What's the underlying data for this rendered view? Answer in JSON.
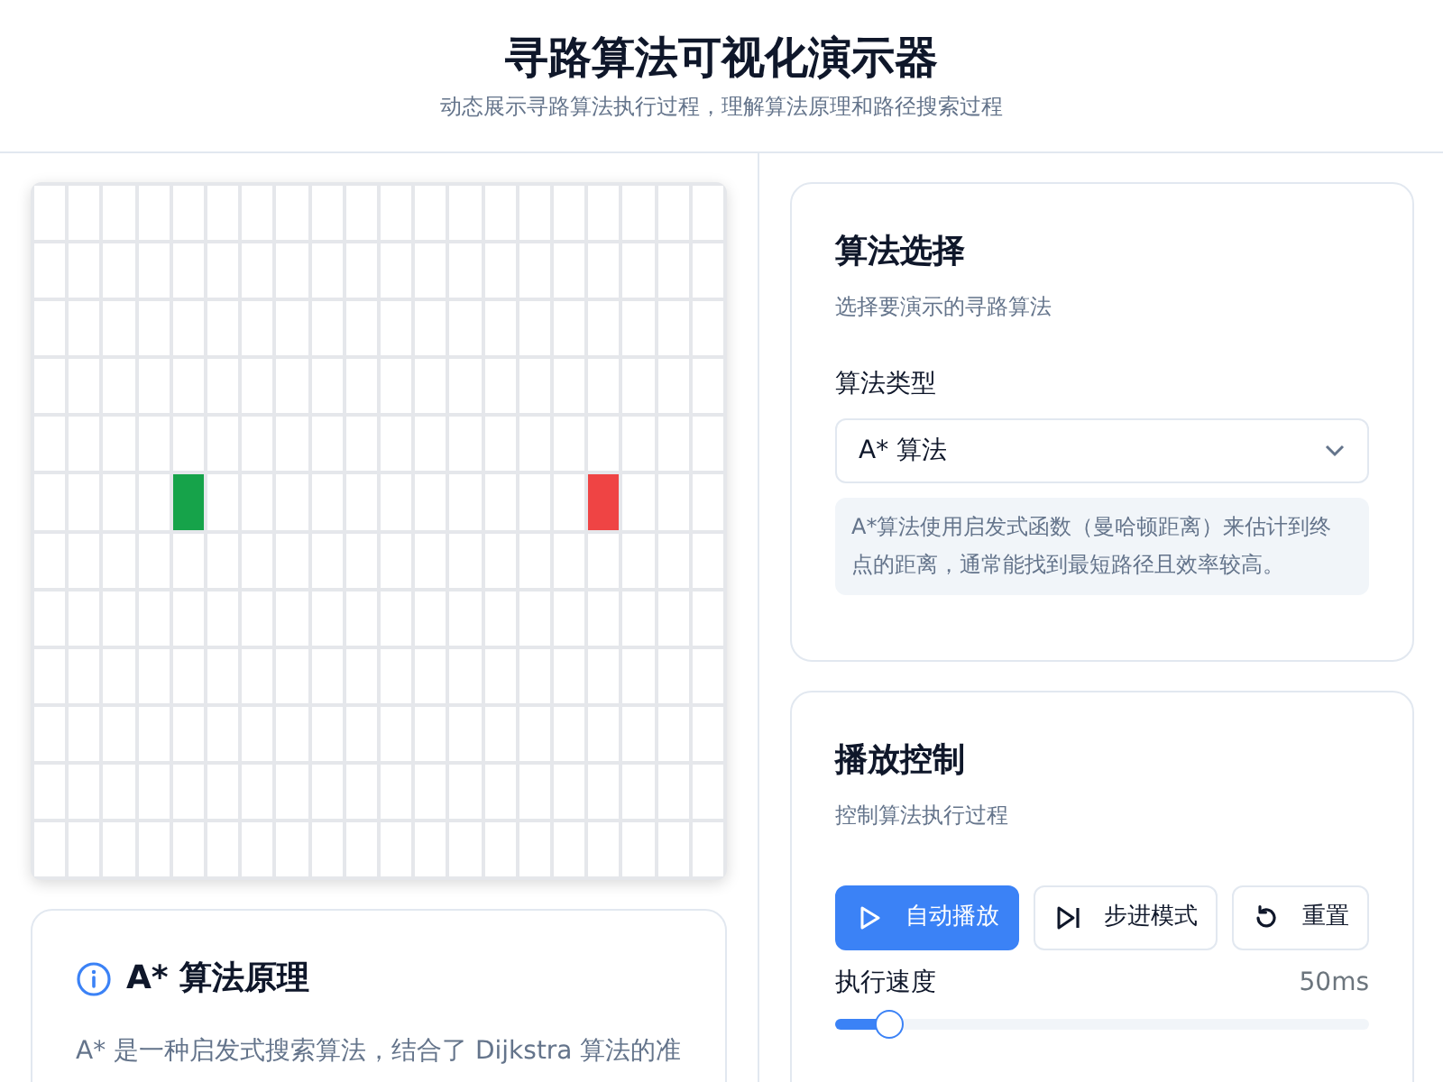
{
  "header": {
    "title": "寻路算法可视化演示器",
    "subtitle": "动态展示寻路算法执行过程，理解算法原理和路径搜索过程"
  },
  "grid": {
    "rows": [
      {
        "cells": [
          {
            "kind": "empty"
          },
          {
            "kind": "empty"
          },
          {
            "kind": "empty"
          },
          {
            "kind": "empty"
          },
          {
            "kind": "empty"
          },
          {
            "kind": "empty"
          },
          {
            "kind": "empty"
          },
          {
            "kind": "empty"
          },
          {
            "kind": "empty"
          },
          {
            "kind": "empty"
          },
          {
            "kind": "empty"
          },
          {
            "kind": "empty"
          },
          {
            "kind": "empty"
          },
          {
            "kind": "empty"
          },
          {
            "kind": "empty"
          },
          {
            "kind": "empty"
          },
          {
            "kind": "empty"
          },
          {
            "kind": "empty"
          },
          {
            "kind": "empty"
          },
          {
            "kind": "empty"
          }
        ]
      },
      {
        "cells": [
          {
            "kind": "empty"
          },
          {
            "kind": "empty"
          },
          {
            "kind": "empty"
          },
          {
            "kind": "empty"
          },
          {
            "kind": "empty"
          },
          {
            "kind": "empty"
          },
          {
            "kind": "empty"
          },
          {
            "kind": "empty"
          },
          {
            "kind": "empty"
          },
          {
            "kind": "empty"
          },
          {
            "kind": "empty"
          },
          {
            "kind": "empty"
          },
          {
            "kind": "empty"
          },
          {
            "kind": "empty"
          },
          {
            "kind": "empty"
          },
          {
            "kind": "empty"
          },
          {
            "kind": "empty"
          },
          {
            "kind": "empty"
          },
          {
            "kind": "empty"
          },
          {
            "kind": "empty"
          }
        ]
      },
      {
        "cells": [
          {
            "kind": "empty"
          },
          {
            "kind": "empty"
          },
          {
            "kind": "empty"
          },
          {
            "kind": "empty"
          },
          {
            "kind": "empty"
          },
          {
            "kind": "empty"
          },
          {
            "kind": "empty"
          },
          {
            "kind": "empty"
          },
          {
            "kind": "empty"
          },
          {
            "kind": "empty"
          },
          {
            "kind": "empty"
          },
          {
            "kind": "empty"
          },
          {
            "kind": "empty"
          },
          {
            "kind": "empty"
          },
          {
            "kind": "empty"
          },
          {
            "kind": "empty"
          },
          {
            "kind": "empty"
          },
          {
            "kind": "empty"
          },
          {
            "kind": "empty"
          },
          {
            "kind": "empty"
          }
        ]
      },
      {
        "cells": [
          {
            "kind": "empty"
          },
          {
            "kind": "empty"
          },
          {
            "kind": "empty"
          },
          {
            "kind": "empty"
          },
          {
            "kind": "empty"
          },
          {
            "kind": "empty"
          },
          {
            "kind": "empty"
          },
          {
            "kind": "empty"
          },
          {
            "kind": "empty"
          },
          {
            "kind": "empty"
          },
          {
            "kind": "empty"
          },
          {
            "kind": "empty"
          },
          {
            "kind": "empty"
          },
          {
            "kind": "empty"
          },
          {
            "kind": "empty"
          },
          {
            "kind": "empty"
          },
          {
            "kind": "empty"
          },
          {
            "kind": "empty"
          },
          {
            "kind": "empty"
          },
          {
            "kind": "empty"
          }
        ]
      },
      {
        "cells": [
          {
            "kind": "empty"
          },
          {
            "kind": "empty"
          },
          {
            "kind": "empty"
          },
          {
            "kind": "empty"
          },
          {
            "kind": "empty"
          },
          {
            "kind": "empty"
          },
          {
            "kind": "empty"
          },
          {
            "kind": "empty"
          },
          {
            "kind": "empty"
          },
          {
            "kind": "empty"
          },
          {
            "kind": "empty"
          },
          {
            "kind": "empty"
          },
          {
            "kind": "empty"
          },
          {
            "kind": "empty"
          },
          {
            "kind": "empty"
          },
          {
            "kind": "empty"
          },
          {
            "kind": "empty"
          },
          {
            "kind": "empty"
          },
          {
            "kind": "empty"
          },
          {
            "kind": "empty"
          }
        ]
      },
      {
        "cells": [
          {
            "kind": "empty"
          },
          {
            "kind": "empty"
          },
          {
            "kind": "empty"
          },
          {
            "kind": "empty"
          },
          {
            "kind": "start"
          },
          {
            "kind": "empty"
          },
          {
            "kind": "empty"
          },
          {
            "kind": "empty"
          },
          {
            "kind": "empty"
          },
          {
            "kind": "empty"
          },
          {
            "kind": "empty"
          },
          {
            "kind": "empty"
          },
          {
            "kind": "empty"
          },
          {
            "kind": "empty"
          },
          {
            "kind": "empty"
          },
          {
            "kind": "empty"
          },
          {
            "kind": "end"
          },
          {
            "kind": "empty"
          },
          {
            "kind": "empty"
          },
          {
            "kind": "empty"
          }
        ]
      },
      {
        "cells": [
          {
            "kind": "empty"
          },
          {
            "kind": "empty"
          },
          {
            "kind": "empty"
          },
          {
            "kind": "empty"
          },
          {
            "kind": "empty"
          },
          {
            "kind": "empty"
          },
          {
            "kind": "empty"
          },
          {
            "kind": "empty"
          },
          {
            "kind": "empty"
          },
          {
            "kind": "empty"
          },
          {
            "kind": "empty"
          },
          {
            "kind": "empty"
          },
          {
            "kind": "empty"
          },
          {
            "kind": "empty"
          },
          {
            "kind": "empty"
          },
          {
            "kind": "empty"
          },
          {
            "kind": "empty"
          },
          {
            "kind": "empty"
          },
          {
            "kind": "empty"
          },
          {
            "kind": "empty"
          }
        ]
      },
      {
        "cells": [
          {
            "kind": "empty"
          },
          {
            "kind": "empty"
          },
          {
            "kind": "empty"
          },
          {
            "kind": "empty"
          },
          {
            "kind": "empty"
          },
          {
            "kind": "empty"
          },
          {
            "kind": "empty"
          },
          {
            "kind": "empty"
          },
          {
            "kind": "empty"
          },
          {
            "kind": "empty"
          },
          {
            "kind": "empty"
          },
          {
            "kind": "empty"
          },
          {
            "kind": "empty"
          },
          {
            "kind": "empty"
          },
          {
            "kind": "empty"
          },
          {
            "kind": "empty"
          },
          {
            "kind": "empty"
          },
          {
            "kind": "empty"
          },
          {
            "kind": "empty"
          },
          {
            "kind": "empty"
          }
        ]
      },
      {
        "cells": [
          {
            "kind": "empty"
          },
          {
            "kind": "empty"
          },
          {
            "kind": "empty"
          },
          {
            "kind": "empty"
          },
          {
            "kind": "empty"
          },
          {
            "kind": "empty"
          },
          {
            "kind": "empty"
          },
          {
            "kind": "empty"
          },
          {
            "kind": "empty"
          },
          {
            "kind": "empty"
          },
          {
            "kind": "empty"
          },
          {
            "kind": "empty"
          },
          {
            "kind": "empty"
          },
          {
            "kind": "empty"
          },
          {
            "kind": "empty"
          },
          {
            "kind": "empty"
          },
          {
            "kind": "empty"
          },
          {
            "kind": "empty"
          },
          {
            "kind": "empty"
          },
          {
            "kind": "empty"
          }
        ]
      },
      {
        "cells": [
          {
            "kind": "empty"
          },
          {
            "kind": "empty"
          },
          {
            "kind": "empty"
          },
          {
            "kind": "empty"
          },
          {
            "kind": "empty"
          },
          {
            "kind": "empty"
          },
          {
            "kind": "empty"
          },
          {
            "kind": "empty"
          },
          {
            "kind": "empty"
          },
          {
            "kind": "empty"
          },
          {
            "kind": "empty"
          },
          {
            "kind": "empty"
          },
          {
            "kind": "empty"
          },
          {
            "kind": "empty"
          },
          {
            "kind": "empty"
          },
          {
            "kind": "empty"
          },
          {
            "kind": "empty"
          },
          {
            "kind": "empty"
          },
          {
            "kind": "empty"
          },
          {
            "kind": "empty"
          }
        ]
      },
      {
        "cells": [
          {
            "kind": "empty"
          },
          {
            "kind": "empty"
          },
          {
            "kind": "empty"
          },
          {
            "kind": "empty"
          },
          {
            "kind": "empty"
          },
          {
            "kind": "empty"
          },
          {
            "kind": "empty"
          },
          {
            "kind": "empty"
          },
          {
            "kind": "empty"
          },
          {
            "kind": "empty"
          },
          {
            "kind": "empty"
          },
          {
            "kind": "empty"
          },
          {
            "kind": "empty"
          },
          {
            "kind": "empty"
          },
          {
            "kind": "empty"
          },
          {
            "kind": "empty"
          },
          {
            "kind": "empty"
          },
          {
            "kind": "empty"
          },
          {
            "kind": "empty"
          },
          {
            "kind": "empty"
          }
        ]
      },
      {
        "cells": [
          {
            "kind": "empty"
          },
          {
            "kind": "empty"
          },
          {
            "kind": "empty"
          },
          {
            "kind": "empty"
          },
          {
            "kind": "empty"
          },
          {
            "kind": "empty"
          },
          {
            "kind": "empty"
          },
          {
            "kind": "empty"
          },
          {
            "kind": "empty"
          },
          {
            "kind": "empty"
          },
          {
            "kind": "empty"
          },
          {
            "kind": "empty"
          },
          {
            "kind": "empty"
          },
          {
            "kind": "empty"
          },
          {
            "kind": "empty"
          },
          {
            "kind": "empty"
          },
          {
            "kind": "empty"
          },
          {
            "kind": "empty"
          },
          {
            "kind": "empty"
          },
          {
            "kind": "empty"
          }
        ]
      }
    ]
  },
  "info_card": {
    "title": "A* 算法原理",
    "text": "A* 是一种启发式搜索算法，结合了 Dijkstra 算法的准"
  },
  "algorithm_card": {
    "title": "算法选择",
    "subtitle": "选择要演示的寻路算法",
    "field_label": "算法类型",
    "select_value": "A* 算法",
    "description": "A*算法使用启发式函数（曼哈顿距离）来估计到终点的距离，通常能找到最短路径且效率较高。"
  },
  "playback_card": {
    "title": "播放控制",
    "subtitle": "控制算法执行过程",
    "buttons": [
      {
        "kind": "play",
        "label": "自动播放",
        "selected": true
      },
      {
        "kind": "step",
        "label": "步进模式",
        "selected": false
      },
      {
        "kind": "reset",
        "label": "重置",
        "selected": false
      }
    ],
    "speed": {
      "label": "执行速度",
      "reading": "50ms",
      "level": 0.1
    }
  }
}
